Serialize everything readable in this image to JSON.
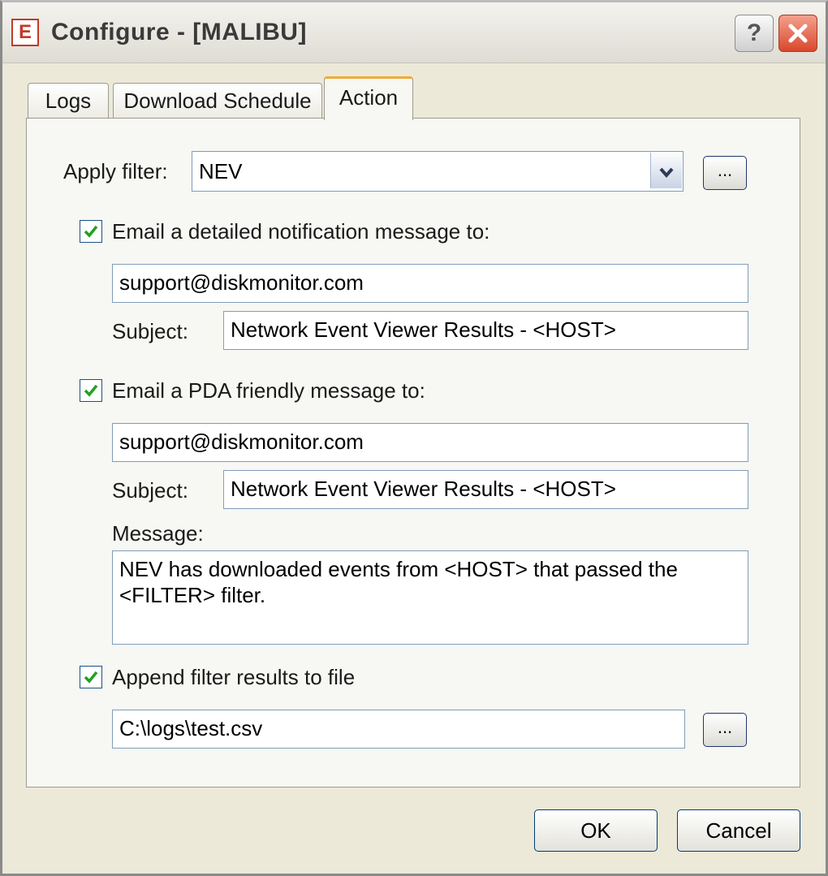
{
  "window": {
    "title": "Configure - [MALIBU]",
    "app_icon_glyph": "E"
  },
  "tabs": [
    {
      "label": "Logs"
    },
    {
      "label": "Download Schedule"
    },
    {
      "label": "Action"
    }
  ],
  "filter": {
    "label": "Apply filter:",
    "value": "NEV",
    "browse_label": "..."
  },
  "email_detailed": {
    "checkbox_label": "Email a detailed notification message to:",
    "checked": true,
    "address": "support@diskmonitor.com",
    "subject_label": "Subject:",
    "subject": "Network Event Viewer Results - <HOST>"
  },
  "email_pda": {
    "checkbox_label": "Email a PDA friendly message to:",
    "checked": true,
    "address": "support@diskmonitor.com",
    "subject_label": "Subject:",
    "subject": "Network Event Viewer Results - <HOST>",
    "message_label": "Message:",
    "message": "NEV has downloaded events from <HOST> that passed the <FILTER> filter."
  },
  "append_file": {
    "checkbox_label": "Append filter results to file",
    "checked": true,
    "path": "C:\\logs\\test.csv",
    "browse_label": "..."
  },
  "buttons": {
    "ok": "OK",
    "cancel": "Cancel"
  },
  "colors": {
    "check": "#21a121",
    "close_button": "#d8482c",
    "active_tab_accent": "#f2a93a"
  },
  "icons": [
    "app-icon",
    "help-icon",
    "close-icon",
    "chevron-down-icon",
    "checkmark-icon"
  ]
}
